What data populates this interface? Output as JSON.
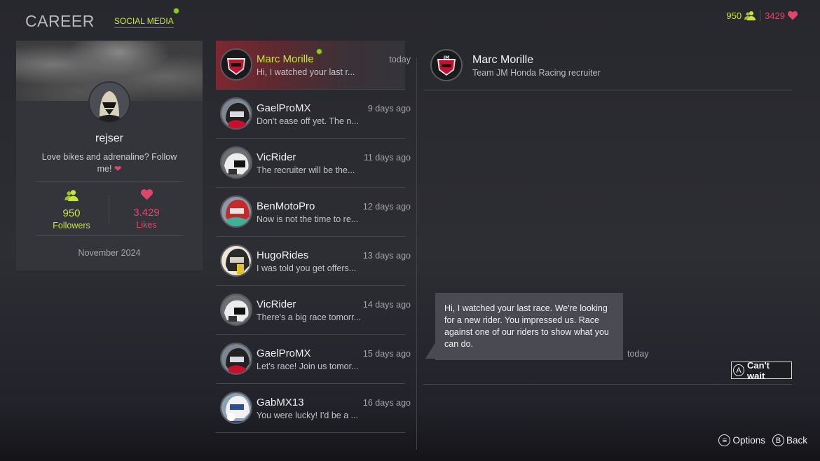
{
  "nav": {
    "career": "CAREER",
    "social_media": "SOCIAL MEDIA"
  },
  "top_stats": {
    "followers": "950",
    "likes": "3429"
  },
  "profile": {
    "username": "rejser",
    "bio": "Love bikes and adrenaline? Follow me!",
    "followers_count": "950",
    "followers_label": "Followers",
    "likes_count": "3.429",
    "likes_label": "Likes",
    "joined": "November 2024"
  },
  "messages": [
    {
      "name": "Marc Morille",
      "when": "today",
      "preview": "Hi, I watched your last r...",
      "active": true,
      "online": true,
      "avatar": "honda-logo"
    },
    {
      "name": "GaelProMX",
      "when": "9 days ago",
      "preview": "Don't ease off yet. The n...",
      "avatar": "helmet-red"
    },
    {
      "name": "VicRider",
      "when": "11 days ago",
      "preview": "The recruiter will be the...",
      "avatar": "helmet-white"
    },
    {
      "name": "BenMotoPro",
      "when": "12 days ago",
      "preview": "Now is not the time to re...",
      "avatar": "helmet-green"
    },
    {
      "name": "HugoRides",
      "when": "13 days ago",
      "preview": "I was told you get offers...",
      "avatar": "helmet-yellow"
    },
    {
      "name": "VicRider",
      "when": "14 days ago",
      "preview": "There's a big race tomorr...",
      "avatar": "helmet-white"
    },
    {
      "name": "GaelProMX",
      "when": "15 days ago",
      "preview": "Let's race! Join us tomor...",
      "avatar": "helmet-red"
    },
    {
      "name": "GabMX13",
      "when": "16 days ago",
      "preview": "You were lucky! I'd be a ...",
      "avatar": "helmet-blue"
    }
  ],
  "conversation": {
    "name": "Marc Morille",
    "role": "Team JM Honda Racing recruiter",
    "message": "Hi, I watched your last race. We're looking for a new rider. You impressed us. Race against one of our riders to show what you can do.",
    "message_when": "today",
    "reply_button_glyph": "A",
    "reply_label": "Can't wait"
  },
  "footer": {
    "options_glyph": "≡",
    "options_label": "Options",
    "back_glyph": "B",
    "back_label": "Back"
  },
  "colors": {
    "accent_green": "#c7e43a",
    "accent_pink": "#e0466a",
    "active_row": "#7e2830"
  }
}
